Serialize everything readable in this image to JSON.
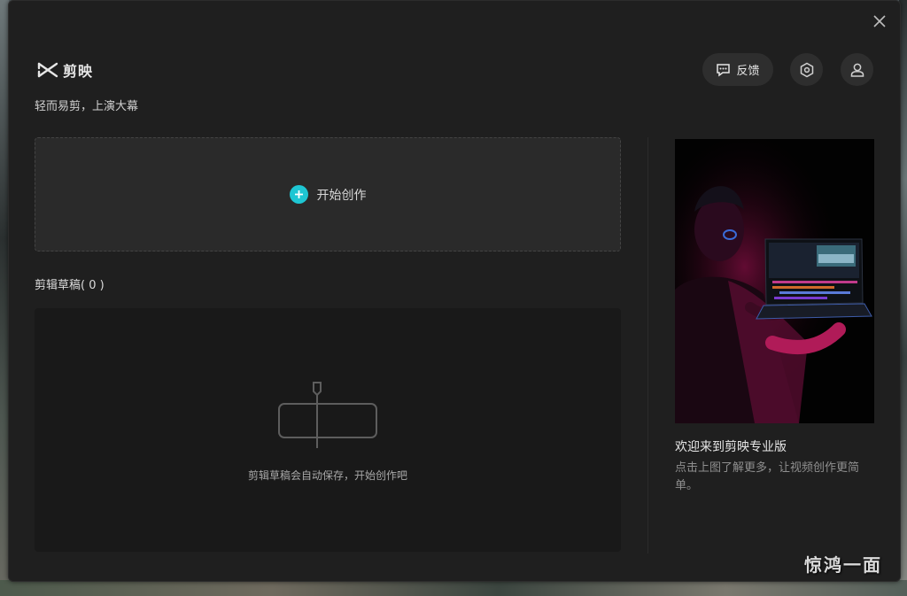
{
  "app": {
    "logo_text": "剪映",
    "slogan": "轻而易剪，上演大幕"
  },
  "header": {
    "feedback_label": "反馈",
    "settings_icon": "settings-hexagon-icon",
    "user_icon": "user-icon",
    "close_icon": "close-icon"
  },
  "create": {
    "label": "开始创作",
    "accent": "#1ec6d3"
  },
  "drafts": {
    "title": "剪辑草稿( 0 )",
    "empty_text": "剪辑草稿会自动保存，开始创作吧"
  },
  "promo": {
    "title": "欢迎来到剪映专业版",
    "description": "点击上图了解更多，让视频创作更简单。"
  },
  "watermark": "惊鸿一面"
}
